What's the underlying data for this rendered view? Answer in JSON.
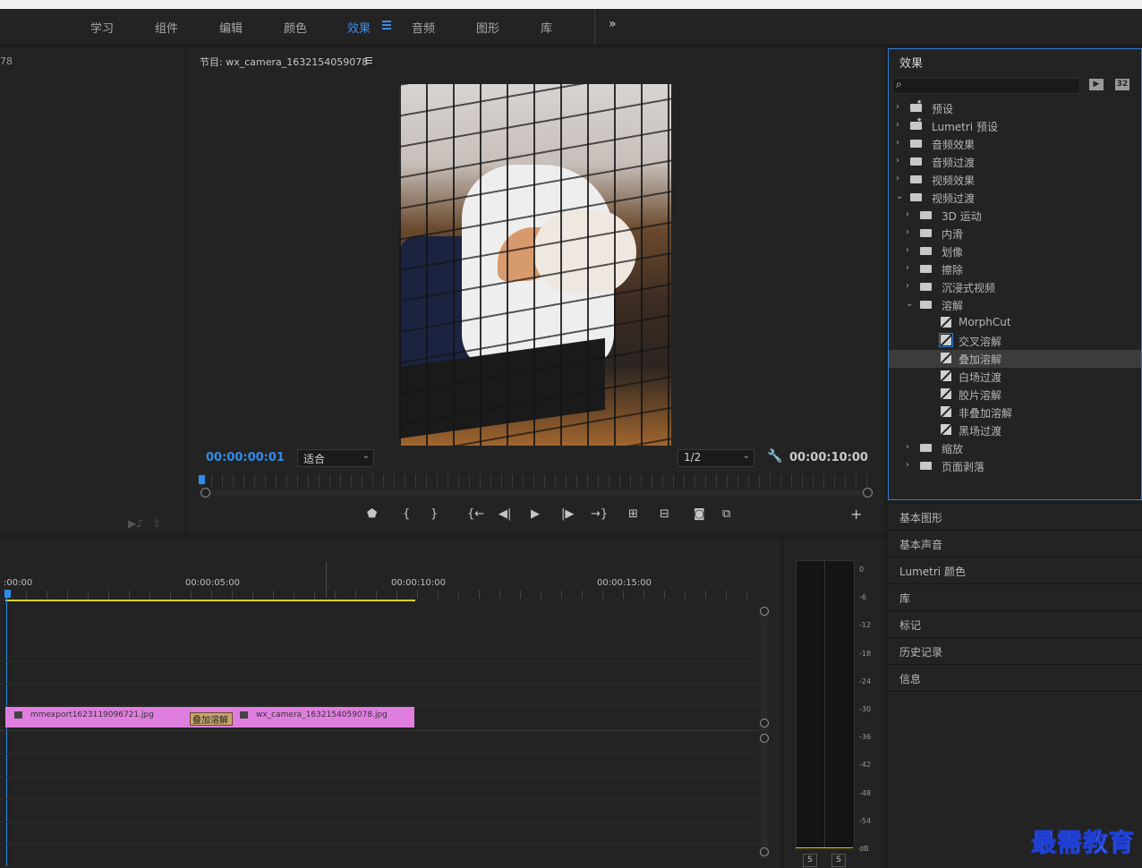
{
  "workspace_tabs": [
    {
      "label": "学习",
      "active": false
    },
    {
      "label": "组件",
      "active": false
    },
    {
      "label": "编辑",
      "active": false
    },
    {
      "label": "颜色",
      "active": false
    },
    {
      "label": "效果",
      "active": true
    },
    {
      "label": "音频",
      "active": false
    },
    {
      "label": "图形",
      "active": false
    },
    {
      "label": "库",
      "active": false
    }
  ],
  "workspace_more": "»",
  "source_panel": {
    "title_fragment": "78"
  },
  "program_monitor": {
    "title": "节目: wx_camera_1632154059078",
    "current_timecode": "00:00:00:01",
    "fit_select": "适合",
    "resolution_select": "1/2",
    "duration_timecode": "00:00:10:00",
    "controls": [
      "marker-icon",
      "mark-in-icon",
      "mark-out-icon",
      "go-to-in-icon",
      "step-back-icon",
      "play-icon",
      "step-forward-icon",
      "go-to-out-icon",
      "lift-icon",
      "extract-icon",
      "camera-icon",
      "compare-icon",
      "add-icon"
    ]
  },
  "effects_panel": {
    "title": "效果",
    "search_placeholder": "",
    "buttons": [
      "32"
    ],
    "tree": [
      {
        "label": "预设",
        "level": 0,
        "type": "folder-star",
        "expanded": false
      },
      {
        "label": "Lumetri 预设",
        "level": 0,
        "type": "folder-star",
        "expanded": false
      },
      {
        "label": "音频效果",
        "level": 0,
        "type": "folder",
        "expanded": false
      },
      {
        "label": "音频过渡",
        "level": 0,
        "type": "folder",
        "expanded": false
      },
      {
        "label": "视频效果",
        "level": 0,
        "type": "folder",
        "expanded": false
      },
      {
        "label": "视频过渡",
        "level": 0,
        "type": "folder",
        "expanded": true
      },
      {
        "label": "3D 运动",
        "level": 1,
        "type": "folder",
        "expanded": false
      },
      {
        "label": "内滑",
        "level": 1,
        "type": "folder",
        "expanded": false
      },
      {
        "label": "划像",
        "level": 1,
        "type": "folder",
        "expanded": false
      },
      {
        "label": "擦除",
        "level": 1,
        "type": "folder",
        "expanded": false
      },
      {
        "label": "沉浸式视频",
        "level": 1,
        "type": "folder",
        "expanded": false
      },
      {
        "label": "溶解",
        "level": 1,
        "type": "folder",
        "expanded": true
      },
      {
        "label": "MorphCut",
        "level": 2,
        "type": "effect",
        "selected": false
      },
      {
        "label": "交叉溶解",
        "level": 2,
        "type": "effect-default",
        "selected": false
      },
      {
        "label": "叠加溶解",
        "level": 2,
        "type": "effect",
        "selected": true
      },
      {
        "label": "白场过渡",
        "level": 2,
        "type": "effect",
        "selected": false
      },
      {
        "label": "胶片溶解",
        "level": 2,
        "type": "effect",
        "selected": false
      },
      {
        "label": "非叠加溶解",
        "level": 2,
        "type": "effect",
        "selected": false
      },
      {
        "label": "黑场过渡",
        "level": 2,
        "type": "effect",
        "selected": false
      },
      {
        "label": "缩放",
        "level": 1,
        "type": "folder",
        "expanded": false
      },
      {
        "label": "页面剥落",
        "level": 1,
        "type": "folder",
        "expanded": false
      }
    ]
  },
  "collapsed_panels": [
    "基本图形",
    "基本声音",
    "Lumetri 颜色",
    "库",
    "标记",
    "历史记录",
    "信息"
  ],
  "timeline": {
    "ruler_labels": [
      ":00:00",
      "00:00:05:00",
      "00:00:10:00",
      "00:00:15:00"
    ],
    "clips": [
      {
        "name": "mmexport1623119096721.jpg"
      },
      {
        "name": "wx_camera_1632154059078.jpg"
      }
    ],
    "transition_label": "叠加溶解"
  },
  "audio_meter": {
    "db_labels": [
      "0",
      "-6",
      "-12",
      "-18",
      "-24",
      "-30",
      "-36",
      "-42",
      "-48",
      "-54",
      "dB"
    ],
    "solo_labels": [
      "S",
      "S"
    ]
  },
  "watermark": "最需教育",
  "colors": {
    "accent": "#2f8ce8",
    "clip": "#e07ee0",
    "transition": "#c7a56d",
    "workarea": "#d6d22c"
  }
}
